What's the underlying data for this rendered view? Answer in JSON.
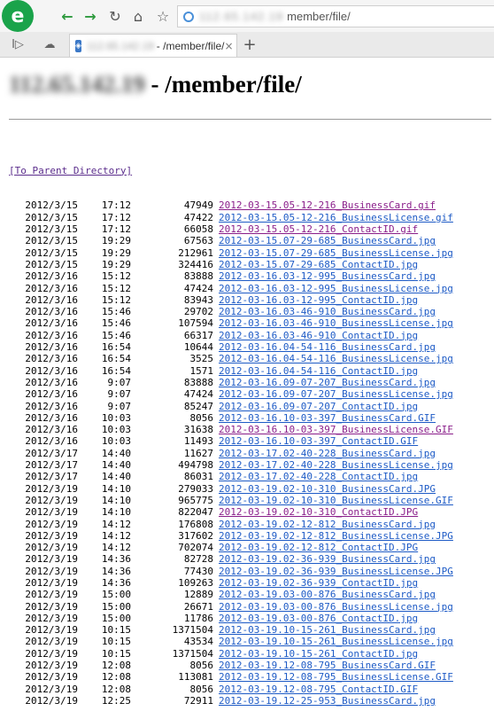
{
  "browser": {
    "logo": "e",
    "address": {
      "host": "112.65.142.19",
      "path": "member/file/"
    },
    "tab": {
      "host": "112.65.142.19",
      "title": " - /member/file/",
      "close": "×"
    },
    "new_tab": "+"
  },
  "page": {
    "heading_host": "112.65.142.19",
    "heading_path": " - /member/file/",
    "parent_link": "[To Parent Directory]",
    "files": [
      {
        "date": "2012/3/15",
        "time": "17:12",
        "size": "47949",
        "name": "2012-03-15.05-12-216_BusinessCard.gif",
        "visited": true
      },
      {
        "date": "2012/3/15",
        "time": "17:12",
        "size": "47422",
        "name": "2012-03-15.05-12-216_BusinessLicense.gif",
        "visited": false
      },
      {
        "date": "2012/3/15",
        "time": "17:12",
        "size": "66058",
        "name": "2012-03-15.05-12-216_ContactID.gif",
        "visited": true
      },
      {
        "date": "2012/3/15",
        "time": "19:29",
        "size": "67563",
        "name": "2012-03-15.07-29-685_BusinessCard.jpg",
        "visited": false
      },
      {
        "date": "2012/3/15",
        "time": "19:29",
        "size": "212961",
        "name": "2012-03-15.07-29-685_BusinessLicense.jpg",
        "visited": false
      },
      {
        "date": "2012/3/15",
        "time": "19:29",
        "size": "324416",
        "name": "2012-03-15.07-29-685_ContactID.jpg",
        "visited": false
      },
      {
        "date": "2012/3/16",
        "time": "15:12",
        "size": "83888",
        "name": "2012-03-16.03-12-995_BusinessCard.jpg",
        "visited": false
      },
      {
        "date": "2012/3/16",
        "time": "15:12",
        "size": "47424",
        "name": "2012-03-16.03-12-995_BusinessLicense.jpg",
        "visited": false
      },
      {
        "date": "2012/3/16",
        "time": "15:12",
        "size": "83943",
        "name": "2012-03-16.03-12-995_ContactID.jpg",
        "visited": false
      },
      {
        "date": "2012/3/16",
        "time": "15:46",
        "size": "29702",
        "name": "2012-03-16.03-46-910_BusinessCard.jpg",
        "visited": false
      },
      {
        "date": "2012/3/16",
        "time": "15:46",
        "size": "107594",
        "name": "2012-03-16.03-46-910_BusinessLicense.jpg",
        "visited": false
      },
      {
        "date": "2012/3/16",
        "time": "15:46",
        "size": "66317",
        "name": "2012-03-16.03-46-910_ContactID.jpg",
        "visited": false
      },
      {
        "date": "2012/3/16",
        "time": "16:54",
        "size": "10644",
        "name": "2012-03-16.04-54-116_BusinessCard.jpg",
        "visited": false
      },
      {
        "date": "2012/3/16",
        "time": "16:54",
        "size": "3525",
        "name": "2012-03-16.04-54-116_BusinessLicense.jpg",
        "visited": false
      },
      {
        "date": "2012/3/16",
        "time": "16:54",
        "size": "1571",
        "name": "2012-03-16.04-54-116_ContactID.jpg",
        "visited": false
      },
      {
        "date": "2012/3/16",
        "time": "9:07",
        "size": "83888",
        "name": "2012-03-16.09-07-207_BusinessCard.jpg",
        "visited": false
      },
      {
        "date": "2012/3/16",
        "time": "9:07",
        "size": "47424",
        "name": "2012-03-16.09-07-207_BusinessLicense.jpg",
        "visited": false
      },
      {
        "date": "2012/3/16",
        "time": "9:07",
        "size": "85247",
        "name": "2012-03-16.09-07-207_ContactID.jpg",
        "visited": false
      },
      {
        "date": "2012/3/16",
        "time": "10:03",
        "size": "8056",
        "name": "2012-03-16.10-03-397_BusinessCard.GIF",
        "visited": false
      },
      {
        "date": "2012/3/16",
        "time": "10:03",
        "size": "31638",
        "name": "2012-03-16.10-03-397_BusinessLicense.GIF",
        "visited": true
      },
      {
        "date": "2012/3/16",
        "time": "10:03",
        "size": "11493",
        "name": "2012-03-16.10-03-397_ContactID.GIF",
        "visited": false
      },
      {
        "date": "2012/3/17",
        "time": "14:40",
        "size": "11627",
        "name": "2012-03-17.02-40-228_BusinessCard.jpg",
        "visited": false
      },
      {
        "date": "2012/3/17",
        "time": "14:40",
        "size": "494798",
        "name": "2012-03-17.02-40-228_BusinessLicense.jpg",
        "visited": false
      },
      {
        "date": "2012/3/17",
        "time": "14:40",
        "size": "86031",
        "name": "2012-03-17.02-40-228_ContactID.jpg",
        "visited": false
      },
      {
        "date": "2012/3/19",
        "time": "14:10",
        "size": "279033",
        "name": "2012-03-19.02-10-310_BusinessCard.JPG",
        "visited": false
      },
      {
        "date": "2012/3/19",
        "time": "14:10",
        "size": "965775",
        "name": "2012-03-19.02-10-310_BusinessLicense.GIF",
        "visited": false
      },
      {
        "date": "2012/3/19",
        "time": "14:10",
        "size": "822047",
        "name": "2012-03-19.02-10-310_ContactID.JPG",
        "visited": true
      },
      {
        "date": "2012/3/19",
        "time": "14:12",
        "size": "176808",
        "name": "2012-03-19.02-12-812_BusinessCard.jpg",
        "visited": false
      },
      {
        "date": "2012/3/19",
        "time": "14:12",
        "size": "317602",
        "name": "2012-03-19.02-12-812_BusinessLicense.JPG",
        "visited": false
      },
      {
        "date": "2012/3/19",
        "time": "14:12",
        "size": "702074",
        "name": "2012-03-19.02-12-812_ContactID.JPG",
        "visited": false
      },
      {
        "date": "2012/3/19",
        "time": "14:36",
        "size": "82728",
        "name": "2012-03-19.02-36-939_BusinessCard.jpg",
        "visited": false
      },
      {
        "date": "2012/3/19",
        "time": "14:36",
        "size": "77430",
        "name": "2012-03-19.02-36-939_BusinessLicense.JPG",
        "visited": false
      },
      {
        "date": "2012/3/19",
        "time": "14:36",
        "size": "109263",
        "name": "2012-03-19.02-36-939_ContactID.jpg",
        "visited": false
      },
      {
        "date": "2012/3/19",
        "time": "15:00",
        "size": "12889",
        "name": "2012-03-19.03-00-876_BusinessCard.jpg",
        "visited": false
      },
      {
        "date": "2012/3/19",
        "time": "15:00",
        "size": "26671",
        "name": "2012-03-19.03-00-876_BusinessLicense.jpg",
        "visited": false
      },
      {
        "date": "2012/3/19",
        "time": "15:00",
        "size": "11786",
        "name": "2012-03-19.03-00-876_ContactID.jpg",
        "visited": false
      },
      {
        "date": "2012/3/19",
        "time": "10:15",
        "size": "1371504",
        "name": "2012-03-19.10-15-261_BusinessCard.jpg",
        "visited": false
      },
      {
        "date": "2012/3/19",
        "time": "10:15",
        "size": "43534",
        "name": "2012-03-19.10-15-261_BusinessLicense.jpg",
        "visited": false
      },
      {
        "date": "2012/3/19",
        "time": "10:15",
        "size": "1371504",
        "name": "2012-03-19.10-15-261_ContactID.jpg",
        "visited": false
      },
      {
        "date": "2012/3/19",
        "time": "12:08",
        "size": "8056",
        "name": "2012-03-19.12-08-795_BusinessCard.GIF",
        "visited": false
      },
      {
        "date": "2012/3/19",
        "time": "12:08",
        "size": "113081",
        "name": "2012-03-19.12-08-795_BusinessLicense.GIF",
        "visited": false
      },
      {
        "date": "2012/3/19",
        "time": "12:08",
        "size": "8056",
        "name": "2012-03-19.12-08-795_ContactID.GIF",
        "visited": false
      },
      {
        "date": "2012/3/19",
        "time": "12:25",
        "size": "72911",
        "name": "2012-03-19.12-25-953_BusinessCard.jpg",
        "visited": false
      }
    ]
  },
  "colors": {
    "link": "#1e5bc6",
    "visited": "#8a1e8a",
    "logo": "#1aa34a"
  },
  "icons": [
    "back-arrow-icon",
    "forward-arrow-icon",
    "reload-icon",
    "home-icon",
    "star-icon",
    "globe-icon",
    "sidebar-toggle-icon",
    "cloud-icon",
    "tab-favicon-icon",
    "close-icon",
    "plus-icon"
  ]
}
